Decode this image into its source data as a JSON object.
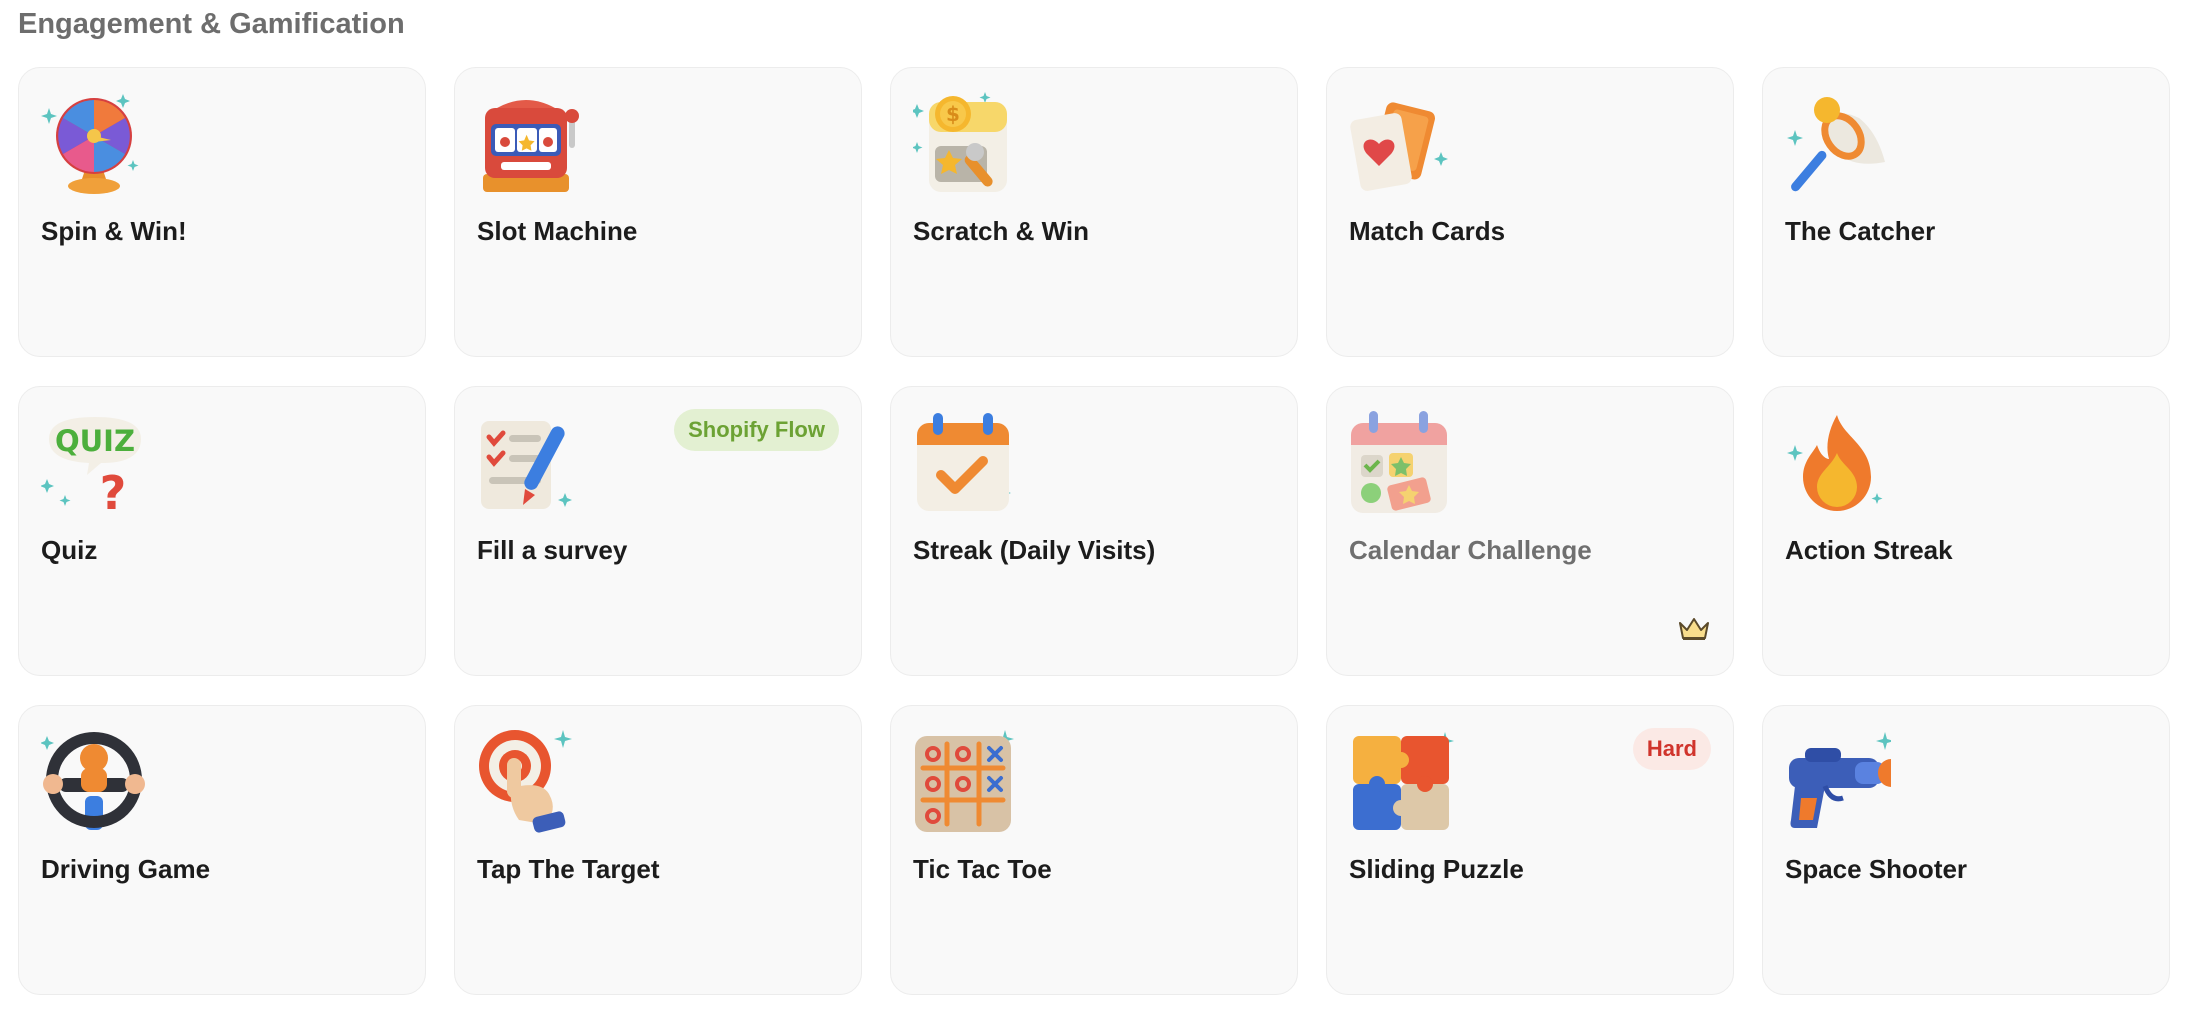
{
  "section": {
    "title": "Engagement & Gamification"
  },
  "colors": {
    "card_bg": "#f9f9f9",
    "title": "#6d6d6d",
    "badge_green": "#6ca234",
    "badge_red": "#d0342c"
  },
  "games": [
    {
      "label": "Spin & Win!",
      "icon": "prize-wheel-icon"
    },
    {
      "label": "Slot Machine",
      "icon": "slot-machine-icon"
    },
    {
      "label": "Scratch & Win",
      "icon": "scratch-card-icon"
    },
    {
      "label": "Match Cards",
      "icon": "cards-icon"
    },
    {
      "label": "The Catcher",
      "icon": "butterfly-net-icon"
    },
    {
      "label": "Quiz",
      "icon": "quiz-bubble-icon"
    },
    {
      "label": "Fill a survey",
      "icon": "survey-checklist-icon",
      "badge": "Shopify Flow"
    },
    {
      "label": "Streak (Daily Visits)",
      "icon": "calendar-check-icon"
    },
    {
      "label": "Calendar Challenge",
      "icon": "calendar-stickers-icon",
      "locked": true,
      "lock_icon": "crown-icon"
    },
    {
      "label": "Action Streak",
      "icon": "flame-icon"
    },
    {
      "label": "Driving Game",
      "icon": "steering-wheel-icon"
    },
    {
      "label": "Tap The Target",
      "icon": "target-tap-icon"
    },
    {
      "label": "Tic Tac Toe",
      "icon": "tic-tac-toe-icon"
    },
    {
      "label": "Sliding Puzzle",
      "icon": "puzzle-icon",
      "badge": "Hard"
    },
    {
      "label": "Space Shooter",
      "icon": "blaster-icon"
    }
  ]
}
